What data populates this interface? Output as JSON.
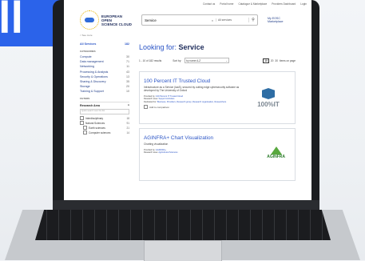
{
  "background": {
    "big_text": "ll",
    "accent": "#2b63ea"
  },
  "topbar": [
    "Contact us",
    "Portal home",
    "Catalogue & Marketplace",
    "Providers Dashboard",
    "Login"
  ],
  "logo": {
    "line1": "EUROPEAN OPEN",
    "line2": "SCIENCE CLOUD"
  },
  "search": {
    "value": "Service",
    "scope": "All services",
    "clear": "×"
  },
  "marketplace_link": "My EOSC Marketplace",
  "breadcrumb": "< See more",
  "sidebar": {
    "all_label": "All Services",
    "all_count": "182",
    "categories_title": "CATEGORIES",
    "categories": [
      {
        "label": "Compute",
        "count": "30"
      },
      {
        "label": "Data management",
        "count": "71"
      },
      {
        "label": "Networking",
        "count": "11"
      },
      {
        "label": "Processing & Analysis",
        "count": "43"
      },
      {
        "label": "Security & Operations",
        "count": "13"
      },
      {
        "label": "Sharing & Discovery",
        "count": "35"
      },
      {
        "label": "Storage",
        "count": "20"
      },
      {
        "label": "Training & Support",
        "count": "10"
      }
    ],
    "filters_title": "FILTERS",
    "research_area": "Research Area",
    "ra_search": "Quick search over the list",
    "checks": [
      {
        "label": "Interdisciplinary",
        "count": "18",
        "sub": false
      },
      {
        "label": "Natural Sciences",
        "count": "91",
        "sub": false
      },
      {
        "label": "Earth sciences",
        "count": "21",
        "sub": true
      },
      {
        "label": "Computer sciences",
        "count": "14",
        "sub": true
      }
    ]
  },
  "main": {
    "looking_prefix": "Looking for:",
    "looking_term": "Service",
    "results": "1 - 10 of 182 results",
    "sort_label": "Sort by:",
    "sort_value": "by name A-Z",
    "per_page": [
      "10",
      "20",
      "30"
    ],
    "per_page_label": "items on page",
    "cards": [
      {
        "title": "100 Percent IT Trusted Cloud",
        "desc": "Infrastructure as a Service (IaaS), secured by cutting edge cybersecurity software as developed by The University of Oxford",
        "provided": "100 Percent IT Trusted Cloud",
        "area": "Support Activities",
        "dedicated": "Business, Providers, Research group, Research organisation, Researchers",
        "compare": "Add to comparison",
        "logo": "100%IT"
      },
      {
        "title": "AGINFRA+ Chart Visualization",
        "desc": "Charting visualization",
        "provided": "AGINFRA+",
        "area": "Agricultural Sciences",
        "logo": "AGINFRA"
      }
    ]
  }
}
